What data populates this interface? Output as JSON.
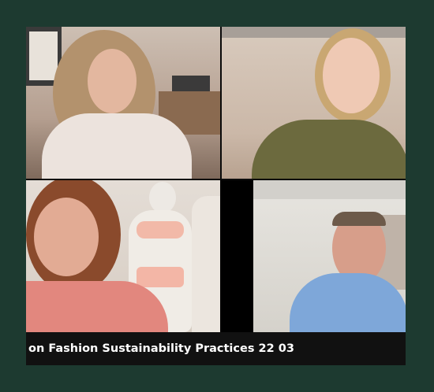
{
  "call": {
    "caption": "on Fashion Sustainability Practices 22 03",
    "participants": [
      {
        "tile": "top-left",
        "description_icon": "person-video"
      },
      {
        "tile": "top-right",
        "description_icon": "person-video"
      },
      {
        "tile": "bottom-left",
        "description_icon": "person-video"
      },
      {
        "tile": "bottom-right",
        "description_icon": "person-video"
      }
    ]
  },
  "colors": {
    "background": "#1d3a30",
    "caption_bar": "#111111",
    "caption_text": "#ffffff"
  }
}
